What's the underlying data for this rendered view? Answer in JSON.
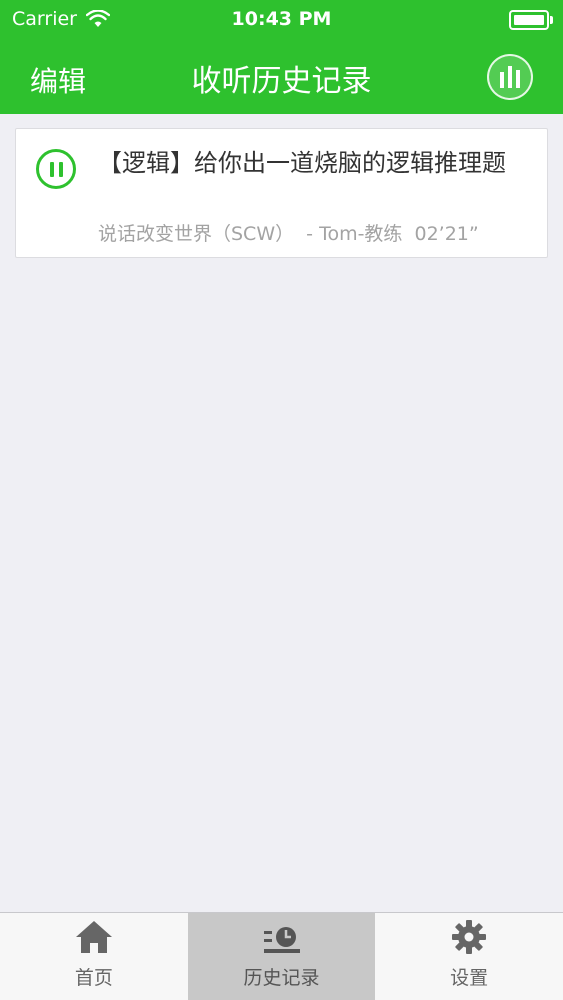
{
  "status_bar": {
    "carrier": "Carrier",
    "time": "10:43 PM"
  },
  "nav": {
    "edit_label": "编辑",
    "title": "收听历史记录"
  },
  "history": [
    {
      "title": "【逻辑】给你出一道烧脑的逻辑推理题",
      "program": "说话改变世界（SCW）",
      "author": "- Tom-教练",
      "duration": "02’21”",
      "state": "playing"
    }
  ],
  "tabs": [
    {
      "label": "首页",
      "icon": "home-icon",
      "active": false
    },
    {
      "label": "历史记录",
      "icon": "history-icon",
      "active": true
    },
    {
      "label": "设置",
      "icon": "gear-icon",
      "active": false
    }
  ],
  "colors": {
    "accent": "#2ec12e",
    "background": "#efeff4",
    "tab_active_bg": "#c8c8c8"
  }
}
